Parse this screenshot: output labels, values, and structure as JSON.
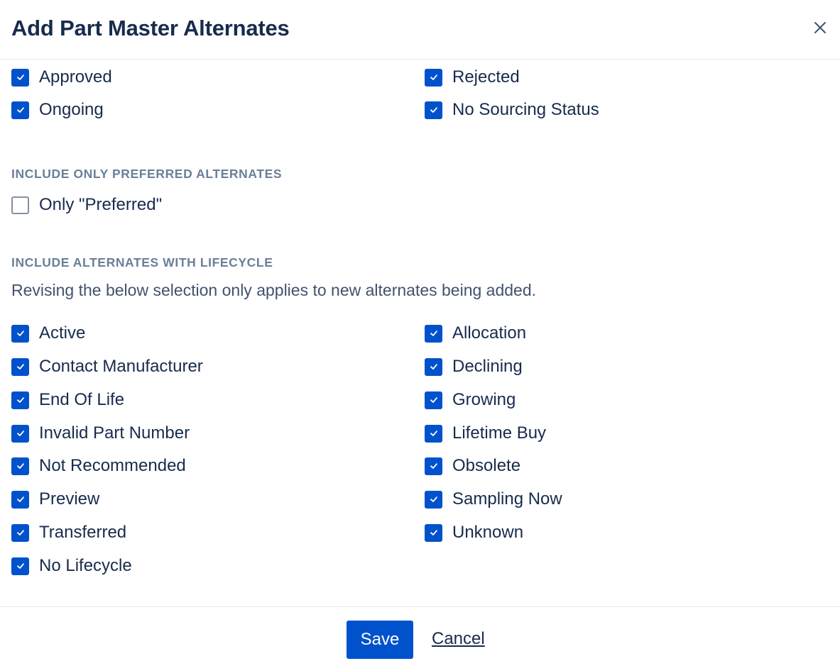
{
  "dialog": {
    "title": "Add Part Master Alternates",
    "close_icon": "close-icon"
  },
  "sourcing_status": {
    "items": [
      {
        "label": "Approved",
        "checked": true
      },
      {
        "label": "Rejected",
        "checked": true
      },
      {
        "label": "Ongoing",
        "checked": true
      },
      {
        "label": "No Sourcing Status",
        "checked": true
      }
    ]
  },
  "preferred": {
    "heading": "INCLUDE ONLY PREFERRED ALTERNATES",
    "option": {
      "label": "Only \"Preferred\"",
      "checked": false
    }
  },
  "lifecycle": {
    "heading": "INCLUDE ALTERNATES WITH LIFECYCLE",
    "note": "Revising the below selection only applies to new alternates being added.",
    "items": [
      {
        "label": "Active",
        "checked": true
      },
      {
        "label": "Allocation",
        "checked": true
      },
      {
        "label": "Contact Manufacturer",
        "checked": true
      },
      {
        "label": "Declining",
        "checked": true
      },
      {
        "label": "End Of Life",
        "checked": true
      },
      {
        "label": "Growing",
        "checked": true
      },
      {
        "label": "Invalid Part Number",
        "checked": true
      },
      {
        "label": "Lifetime Buy",
        "checked": true
      },
      {
        "label": "Not Recommended",
        "checked": true
      },
      {
        "label": "Obsolete",
        "checked": true
      },
      {
        "label": "Preview",
        "checked": true
      },
      {
        "label": "Sampling Now",
        "checked": true
      },
      {
        "label": "Transferred",
        "checked": true
      },
      {
        "label": "Unknown",
        "checked": true
      },
      {
        "label": "No Lifecycle",
        "checked": true
      }
    ]
  },
  "footer": {
    "save_label": "Save",
    "cancel_label": "Cancel"
  },
  "colors": {
    "accent": "#0052cc",
    "text": "#172b4d",
    "heading": "#6b7f99"
  }
}
